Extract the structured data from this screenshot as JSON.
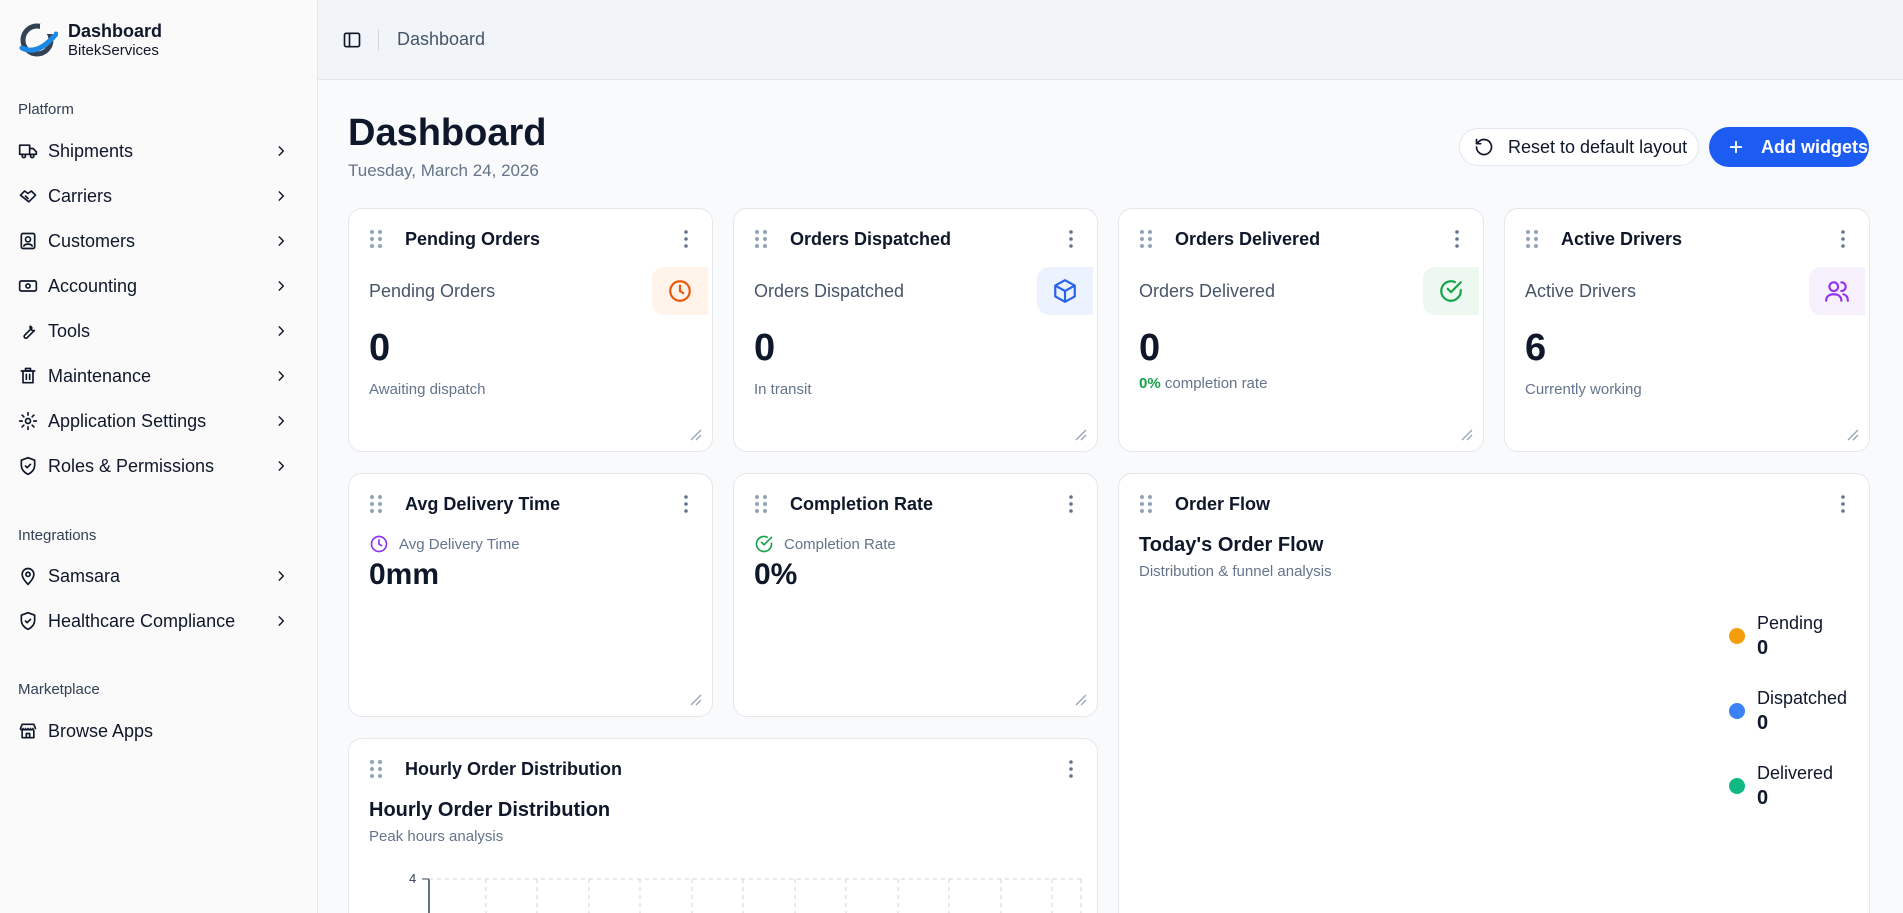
{
  "brand": {
    "title": "Dashboard",
    "subtitle": "BitekServices"
  },
  "sidebar": {
    "platform_label": "Platform",
    "platform_items": [
      {
        "label": "Shipments",
        "icon": "truck-icon"
      },
      {
        "label": "Carriers",
        "icon": "handshake-icon"
      },
      {
        "label": "Customers",
        "icon": "contact-icon"
      },
      {
        "label": "Accounting",
        "icon": "banknote-icon"
      },
      {
        "label": "Tools",
        "icon": "wrench-icon"
      },
      {
        "label": "Maintenance",
        "icon": "trash-icon"
      },
      {
        "label": "Application Settings",
        "icon": "gear-icon"
      },
      {
        "label": "Roles & Permissions",
        "icon": "shield-check-icon"
      }
    ],
    "integrations_label": "Integrations",
    "integration_items": [
      {
        "label": "Samsara",
        "icon": "map-pin-icon"
      },
      {
        "label": "Healthcare Compliance",
        "icon": "shield-check-icon"
      }
    ],
    "marketplace_label": "Marketplace",
    "marketplace_items": [
      {
        "label": "Browse Apps",
        "icon": "store-icon"
      }
    ]
  },
  "topbar": {
    "breadcrumb": "Dashboard"
  },
  "header": {
    "title": "Dashboard",
    "date": "Tuesday, March 24, 2026",
    "reset_label": "Reset to default layout",
    "add_label": "Add widgets"
  },
  "stats": [
    {
      "title": "Pending Orders",
      "label": "Pending Orders",
      "value": "0",
      "sub": "Awaiting dispatch",
      "icon": "clock-icon",
      "color": "#ea580c",
      "badge_bg": "#fff3ea"
    },
    {
      "title": "Orders Dispatched",
      "label": "Orders Dispatched",
      "value": "0",
      "sub": "In transit",
      "icon": "package-icon",
      "color": "#2563eb",
      "badge_bg": "#ecf2fe"
    },
    {
      "title": "Orders Delivered",
      "label": "Orders Delivered",
      "value": "0",
      "sub_highlight": "0%",
      "sub": "completion rate",
      "icon": "check-circle-icon",
      "color": "#16a34a",
      "badge_bg": "#edf9f0"
    },
    {
      "title": "Active Drivers",
      "label": "Active Drivers",
      "value": "6",
      "sub": "Currently working",
      "icon": "users-icon",
      "color": "#9333ea",
      "badge_bg": "#f7f0fd"
    }
  ],
  "avg_delivery": {
    "title": "Avg Delivery Time",
    "label": "Avg Delivery Time",
    "value": "0mm",
    "icon": "clock-icon",
    "color": "#9333ea"
  },
  "completion_rate": {
    "title": "Completion Rate",
    "label": "Completion Rate",
    "value": "0%",
    "icon": "check-circle-icon",
    "color": "#16a34a"
  },
  "order_flow": {
    "title": "Order Flow",
    "heading": "Today's Order Flow",
    "subheading": "Distribution & funnel analysis",
    "legend": [
      {
        "name": "Pending",
        "value": "0",
        "color": "#f59e0b"
      },
      {
        "name": "Dispatched",
        "value": "0",
        "color": "#3b82f6"
      },
      {
        "name": "Delivered",
        "value": "0",
        "color": "#10b981"
      }
    ]
  },
  "hourly": {
    "title": "Hourly Order Distribution",
    "heading": "Hourly Order Distribution",
    "subheading": "Peak hours analysis",
    "y_tick_top": "4"
  }
}
